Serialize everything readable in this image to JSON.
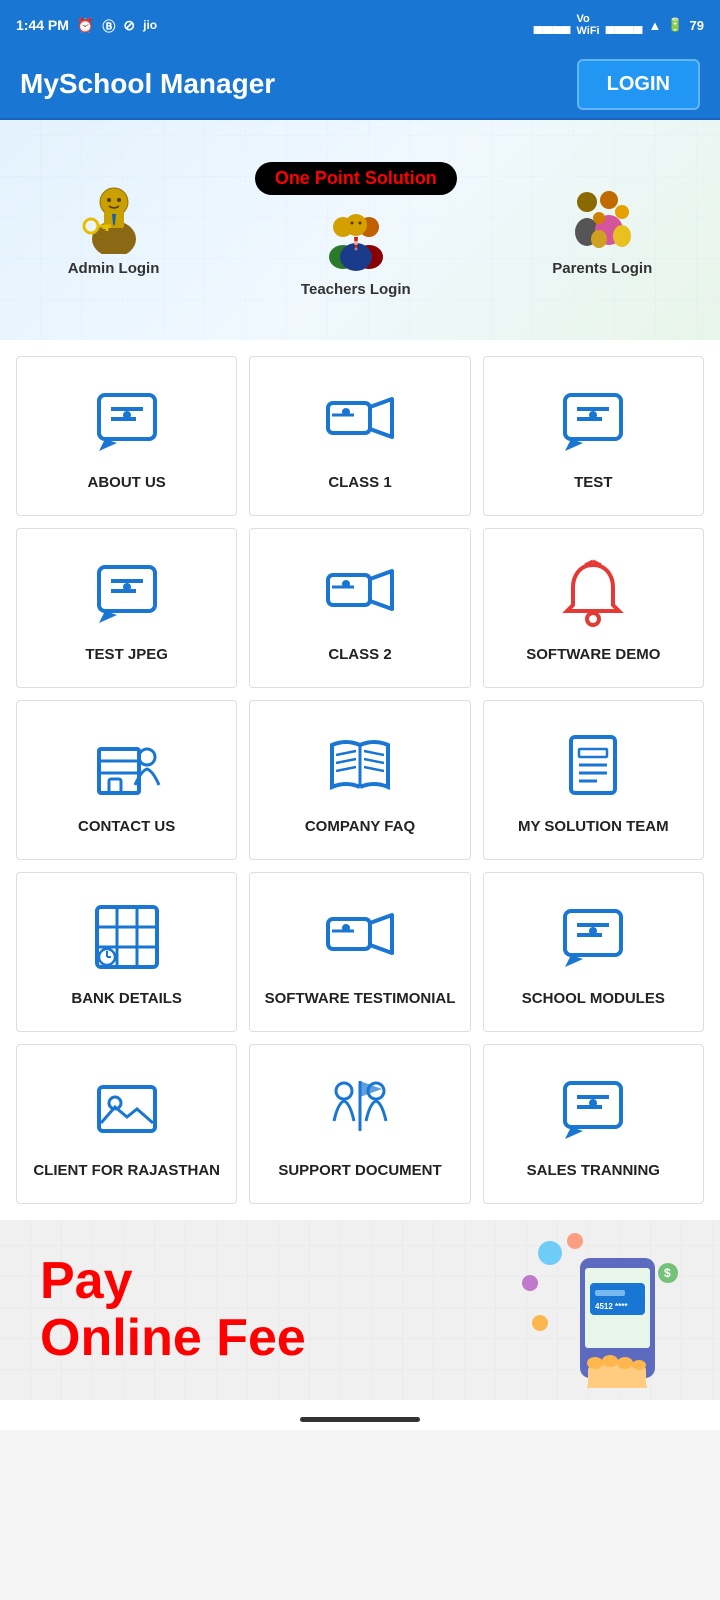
{
  "statusBar": {
    "time": "1:44 PM",
    "battery": "79"
  },
  "appBar": {
    "title": "MySchool Manager",
    "loginLabel": "LOGIN"
  },
  "banner": {
    "tagline": "One Point Solution",
    "adminLabel": "Admin Login",
    "teachersLabel": "Teachers Login",
    "parentsLabel": "Parents Login"
  },
  "gridItems": [
    {
      "id": "about-us",
      "label": "ABOUT US",
      "icon": "info-chat"
    },
    {
      "id": "class-1",
      "label": "CLASS 1",
      "icon": "video-camera"
    },
    {
      "id": "test",
      "label": "TEST",
      "icon": "info-chat"
    },
    {
      "id": "test-jpeg",
      "label": "TEST JPEG",
      "icon": "info-chat"
    },
    {
      "id": "class-2",
      "label": "CLASS 2",
      "icon": "video-camera"
    },
    {
      "id": "software-demo",
      "label": "SOFTWARE DEMO",
      "icon": "bell"
    },
    {
      "id": "contact-us",
      "label": "CONTACT US",
      "icon": "building-person"
    },
    {
      "id": "company-faq",
      "label": "COMPANY FAQ",
      "icon": "open-book"
    },
    {
      "id": "my-solution-team",
      "label": "MY SOLUTION TEAM",
      "icon": "document-list"
    },
    {
      "id": "bank-details",
      "label": "BANK DETAILS",
      "icon": "grid-clock"
    },
    {
      "id": "software-testimonial",
      "label": "SOFTWARE TESTIMONIAL",
      "icon": "video-camera"
    },
    {
      "id": "school-modules",
      "label": "SCHOOL MODULES",
      "icon": "info-chat"
    },
    {
      "id": "client-rajasthan",
      "label": "CLIENT FOR RAJASTHAN",
      "icon": "image-frame"
    },
    {
      "id": "support-document",
      "label": "SUPPORT DOCUMENT",
      "icon": "people-flag"
    },
    {
      "id": "sales-tranning",
      "label": "SALES TRANNING",
      "icon": "info-chat"
    }
  ],
  "footerBanner": {
    "line1": "Pay",
    "line2": "Online Fee"
  }
}
